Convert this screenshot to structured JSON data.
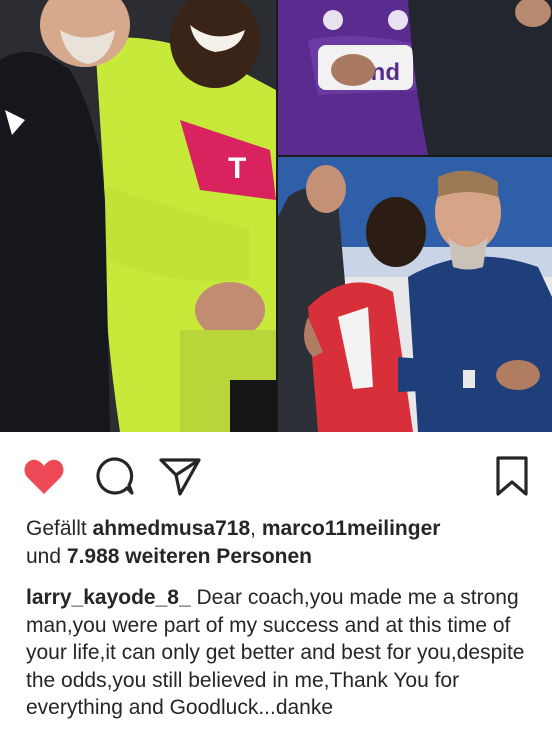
{
  "post": {
    "photos": [
      {
        "subject": "coach and player in yellow kit embracing"
      },
      {
        "subject": "player in purple kit hugging coach"
      },
      {
        "subject": "player in red kit hugging coach in blue suit"
      }
    ],
    "kit_text_telekom": "T",
    "kit_text_sponsor": "und"
  },
  "actions": {
    "like_color": "#ed4956",
    "icon_color": "#262626"
  },
  "likes": {
    "prefix": "Gefällt",
    "user1": "ahmedmusa718",
    "separator": ",",
    "user2": "marco11meilinger",
    "and": "und",
    "count_text": "7.988 weiteren Personen"
  },
  "caption": {
    "username": "larry_kayode_8_",
    "text": "Dear coach,you made me a strong man,you were part of my success and at this time of your life,it can only get better and best for you,despite the odds,you still believed in me,Thank You for everything and Goodluck...danke"
  }
}
